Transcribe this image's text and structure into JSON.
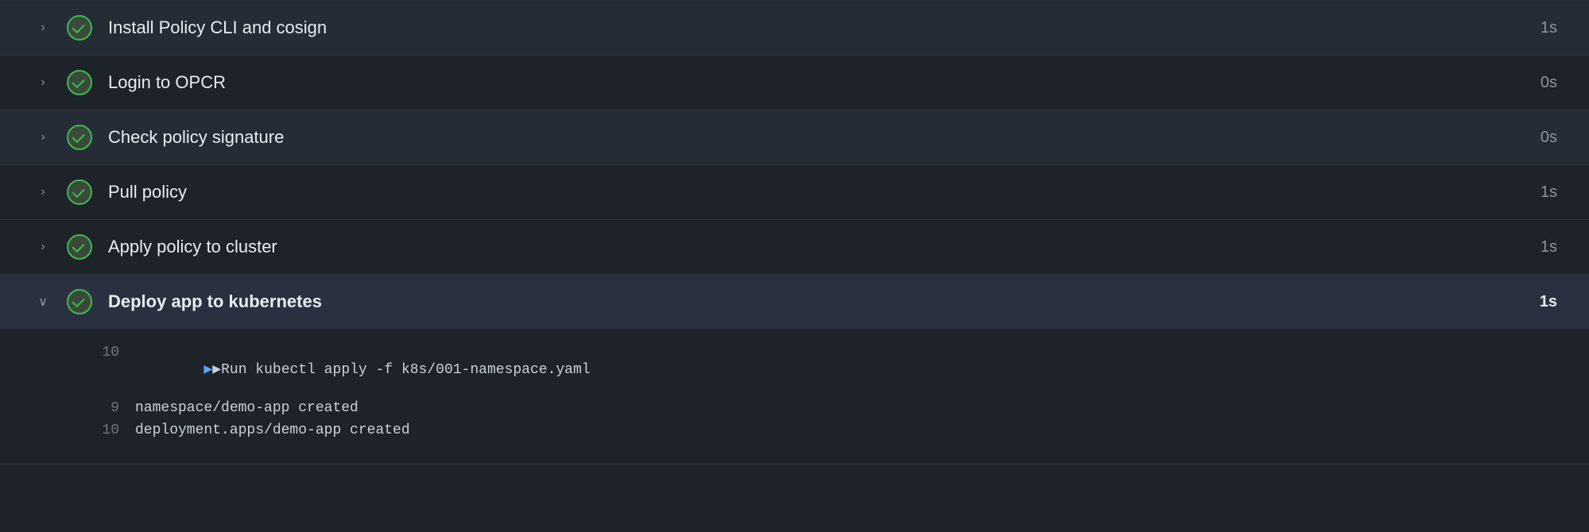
{
  "steps": [
    {
      "id": "install-policy",
      "label": "Install Policy CLI and cosign",
      "duration": "1s",
      "expanded": false,
      "highlighted": false,
      "chevron": "›",
      "status": "success"
    },
    {
      "id": "login-opcr",
      "label": "Login to OPCR",
      "duration": "0s",
      "expanded": false,
      "highlighted": false,
      "chevron": "›",
      "status": "success"
    },
    {
      "id": "check-policy-signature",
      "label": "Check policy signature",
      "duration": "0s",
      "expanded": false,
      "highlighted": true,
      "chevron": "›",
      "status": "success"
    },
    {
      "id": "pull-policy",
      "label": "Pull policy",
      "duration": "1s",
      "expanded": false,
      "highlighted": false,
      "chevron": "›",
      "status": "success"
    },
    {
      "id": "apply-policy",
      "label": "Apply policy to cluster",
      "duration": "1s",
      "expanded": false,
      "highlighted": false,
      "chevron": "›",
      "status": "success"
    },
    {
      "id": "deploy-kubernetes",
      "label": "Deploy app to kubernetes",
      "duration": "1s",
      "expanded": true,
      "highlighted": false,
      "chevron": "∨",
      "status": "success"
    }
  ],
  "output_lines": [
    {
      "number": "10",
      "content": "▶Run kubectl apply -f k8s/001-namespace.yaml",
      "is_command": true
    },
    {
      "number": "9",
      "content": "namespace/demo-app created",
      "is_command": false
    },
    {
      "number": "10",
      "content": "deployment.apps/demo-app created",
      "is_command": false
    }
  ],
  "colors": {
    "bg_main": "#1e2229",
    "bg_row_hover": "#262c35",
    "bg_row_highlighted": "#262c35",
    "bg_row_expanded": "#2b3040",
    "text_primary": "#e6edf3",
    "text_secondary": "#8b949e",
    "text_muted": "#6e7681",
    "success_green": "#3fb950",
    "border": "#2d333b",
    "command_blue": "#58a6ff"
  }
}
